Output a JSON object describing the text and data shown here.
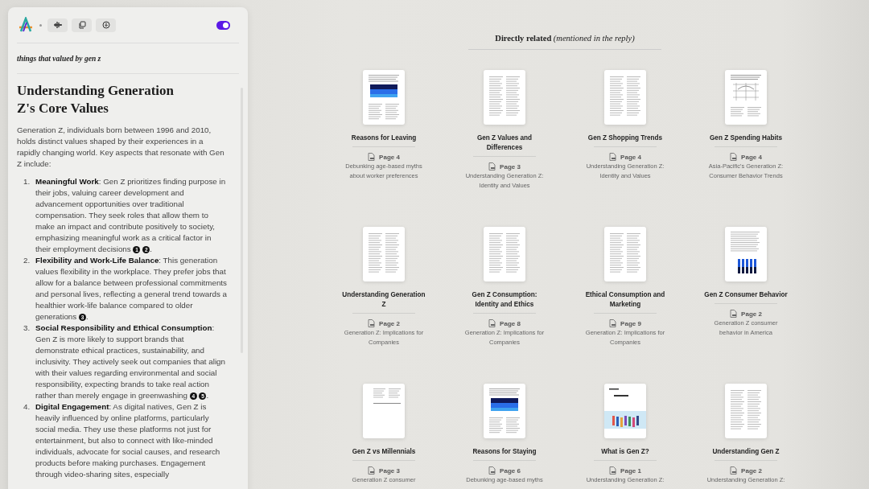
{
  "panel": {
    "toggle": {
      "on": true
    },
    "query": "things that valued by gen z",
    "heading": "Understanding Generation Z's Core Values",
    "intro": "Generation Z, individuals born between 1996 and 2010, holds distinct values shaped by their experiences in a rapidly changing world. Key aspects that resonate with Gen Z include:",
    "points": [
      {
        "number": "1.",
        "title": "Meaningful Work",
        "text": ": Gen Z prioritizes finding purpose in their jobs, valuing career development and advancement opportunities over traditional compensation. They seek roles that allow them to make an impact and contribute positively to society, emphasizing meaningful work as a critical factor in their employment decisions",
        "citations": [
          "1",
          "2"
        ],
        "end": "."
      },
      {
        "number": "2.",
        "title": "Flexibility and Work-Life Balance",
        "text": ": This generation values flexibility in the workplace. They prefer jobs that allow for a balance between professional commitments and personal lives, reflecting a general trend towards a healthier work-life balance compared to older generations",
        "citations": [
          "3"
        ],
        "end": "."
      },
      {
        "number": "3.",
        "title": "Social Responsibility and Ethical Consumption",
        "text": ": Gen Z is more likely to support brands that demonstrate ethical practices, sustainability, and inclusivity. They actively seek out companies that align with their values regarding environmental and social responsibility, expecting brands to take real action rather than merely engage in greenwashing",
        "citations": [
          "4",
          "5"
        ],
        "end": "."
      },
      {
        "number": "4.",
        "title": "Digital Engagement",
        "text": ": As digital natives, Gen Z is heavily influenced by online platforms, particularly social media. They use these platforms not just for entertainment, but also to connect with like-minded individuals, advocate for social causes, and research products before making purchases. Engagement through video-sharing sites, especially"
      }
    ]
  },
  "related": {
    "title": "Directly related",
    "note": "(mentioned in the reply)",
    "sources": [
      {
        "title": "Reasons for Leaving",
        "page": "Page 4",
        "document": "Debunking age-based myths about worker preferences",
        "kind": "table"
      },
      {
        "title": "Gen Z Values and Differences",
        "page": "Page 3",
        "document": "Understanding Generation Z: Identity and Values",
        "kind": "text"
      },
      {
        "title": "Gen Z Shopping Trends",
        "page": "Page 4",
        "document": "Understanding Generation Z: Identity and Values",
        "kind": "text"
      },
      {
        "title": "Gen Z Spending Habits",
        "page": "Page 4",
        "document": "Asia-Pacific's Generation Z: Consumer Behavior Trends",
        "kind": "diagram"
      },
      {
        "title": "Understanding Generation Z",
        "page": "Page 2",
        "document": "Generation Z: Implications for Companies",
        "kind": "text"
      },
      {
        "title": "Gen Z Consumption: Identity and Ethics",
        "page": "Page 8",
        "document": "Generation Z: Implications for Companies",
        "kind": "text"
      },
      {
        "title": "Ethical Consumption and Marketing",
        "page": "Page 9",
        "document": "Generation Z: Implications for Companies",
        "kind": "text"
      },
      {
        "title": "Gen Z Consumer Behavior",
        "page": "Page 2",
        "document": "Generation Z consumer behavior in America",
        "kind": "chart"
      },
      {
        "title": "Gen Z vs Millennials",
        "page": "Page 3",
        "document": "Generation Z consumer",
        "kind": "sparse"
      },
      {
        "title": "Reasons for Staying",
        "page": "Page 6",
        "document": "Debunking age-based myths",
        "kind": "table"
      },
      {
        "title": "What is Gen Z?",
        "page": "Page 1",
        "document": "Understanding Generation Z:",
        "kind": "cover"
      },
      {
        "title": "Understanding Gen Z",
        "page": "Page 2",
        "document": "Understanding Generation Z:",
        "kind": "text"
      }
    ]
  }
}
